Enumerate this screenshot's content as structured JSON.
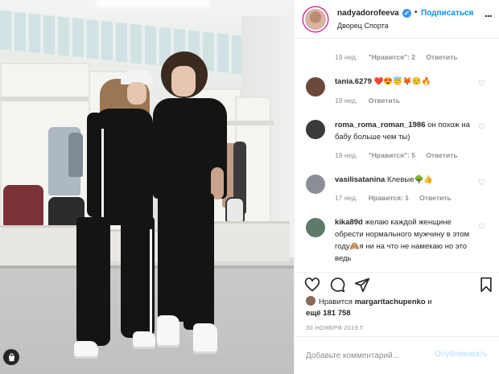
{
  "header": {
    "username": "nadyadorofeeva",
    "verified_mark": "✔",
    "separator": "•",
    "follow_label": "Подписаться",
    "location": "Дворец Спорта",
    "more_label": "..."
  },
  "comments": [
    {
      "partial": true,
      "time": "19 нед.",
      "likes": "\"Нравится\": 2",
      "reply": "Ответить"
    },
    {
      "username": "tania.6279",
      "text": "❤️😍😇🦊☺️🔥",
      "time": "19 нед.",
      "reply": "Ответить",
      "avatar_color": "#6b4a3a"
    },
    {
      "username": "roma_roma_roman_1986",
      "text": "он похож на бабу больше чем ты)",
      "time": "19 нед.",
      "likes": "\"Нравится\": 5",
      "reply": "Ответить",
      "avatar_color": "#3a3a3a"
    },
    {
      "username": "vasilisatanina",
      "text": "Клевые🌳👍",
      "time": "17 нед.",
      "likes": "Нравится: 1",
      "reply": "Ответить",
      "avatar_color": "#8b8f95"
    },
    {
      "username": "kika89d",
      "text": "желаю каждой женщине обрести нормального мужчину в этом году🙈я ни на что не намекаю но это ведь",
      "avatar_color": "#5e7a6a"
    }
  ],
  "likes_section": {
    "prefix": "Нравится",
    "user": "margaritachupenko",
    "conj": "и",
    "others": "ещё 181 758"
  },
  "date": "30 НОЯБРЯ 2019 Г.",
  "add_comment": {
    "placeholder": "Добавьте комментарий...",
    "publish_label": "Опубликовать"
  },
  "colors": {
    "accent": "#0095f6",
    "publish_disabled": "#b2dffc",
    "muted": "#8e8e8e",
    "text": "#262626"
  },
  "icons": [
    "shopping-bag-icon",
    "verified-badge-icon",
    "more-options-icon",
    "heart-icon",
    "comment-icon",
    "share-icon",
    "bookmark-icon"
  ]
}
